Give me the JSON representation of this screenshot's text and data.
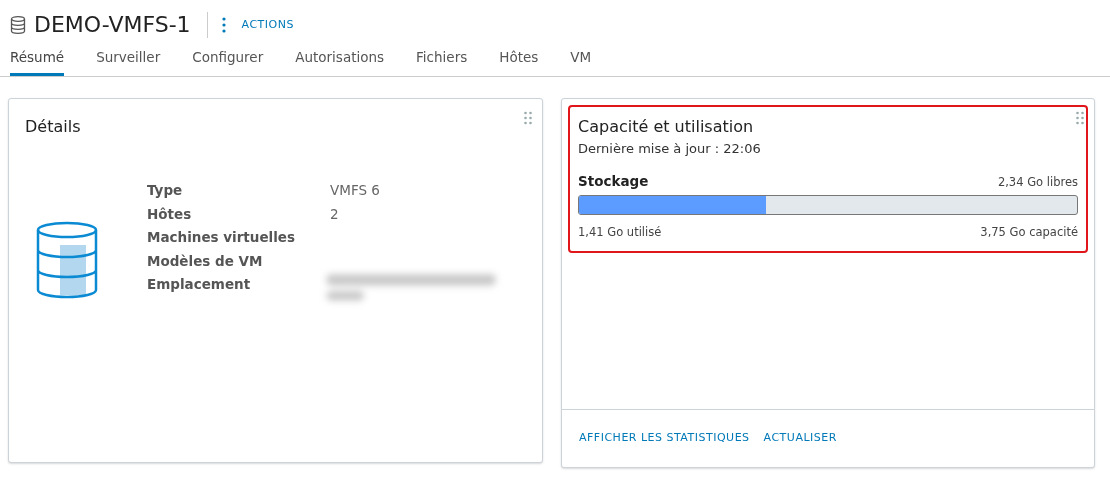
{
  "header": {
    "title": "DEMO-VMFS-1",
    "actions_label": "ACTIONS"
  },
  "tabs": [
    {
      "label": "Résumé",
      "selected": true
    },
    {
      "label": "Surveiller",
      "selected": false
    },
    {
      "label": "Configurer",
      "selected": false
    },
    {
      "label": "Autorisations",
      "selected": false
    },
    {
      "label": "Fichiers",
      "selected": false
    },
    {
      "label": "Hôtes",
      "selected": false
    },
    {
      "label": "VM",
      "selected": false
    }
  ],
  "details_card": {
    "title": "Détails",
    "rows": [
      {
        "label": "Type",
        "value": "VMFS 6"
      },
      {
        "label": "Hôtes",
        "value": "2"
      },
      {
        "label": "Machines virtuelles"
      },
      {
        "label": "Modèles de VM"
      },
      {
        "label": "Emplacement",
        "redacted": true
      }
    ]
  },
  "capacity_card": {
    "title": "Capacité et utilisation",
    "highlighted": true,
    "updated": "Dernière mise à jour : 22:06",
    "storage": {
      "label": "Stockage",
      "free": "2,34 Go libres",
      "level": 0.376,
      "used": "1,41 Go utilisé",
      "capacity": "3,75 Go capacité"
    },
    "links": [
      "AFFICHER LES STATISTIQUES",
      "ACTUALISER"
    ]
  }
}
